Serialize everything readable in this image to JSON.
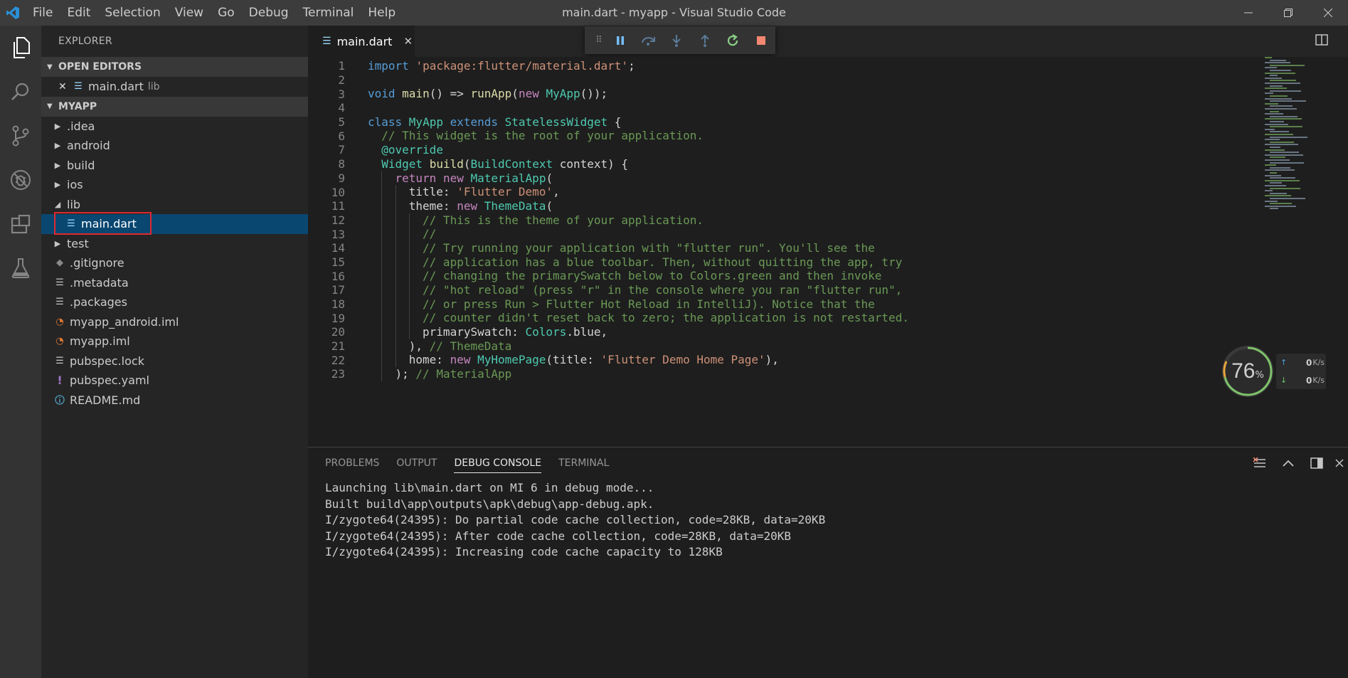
{
  "window": {
    "title": "main.dart - myapp - Visual Studio Code",
    "menu": [
      "File",
      "Edit",
      "Selection",
      "View",
      "Go",
      "Debug",
      "Terminal",
      "Help"
    ]
  },
  "activity_bar": [
    "files-icon",
    "search-icon",
    "source-control-icon",
    "debug-icon",
    "extensions-icon",
    "flask-icon"
  ],
  "sidebar": {
    "header": "EXPLORER",
    "open_editors_label": "OPEN EDITORS",
    "open_editors": [
      {
        "name": "main.dart",
        "folder": "lib"
      }
    ],
    "project_label": "MYAPP",
    "tree": [
      {
        "label": ".idea",
        "kind": "folder"
      },
      {
        "label": "android",
        "kind": "folder"
      },
      {
        "label": "build",
        "kind": "folder"
      },
      {
        "label": "ios",
        "kind": "folder"
      },
      {
        "label": "lib",
        "kind": "folder-open"
      },
      {
        "label": "main.dart",
        "kind": "file",
        "selected": true
      },
      {
        "label": "test",
        "kind": "folder"
      },
      {
        "label": ".gitignore",
        "kind": "git"
      },
      {
        "label": ".metadata",
        "kind": "text"
      },
      {
        "label": ".packages",
        "kind": "text"
      },
      {
        "label": "myapp_android.iml",
        "kind": "rss"
      },
      {
        "label": "myapp.iml",
        "kind": "rss"
      },
      {
        "label": "pubspec.lock",
        "kind": "text"
      },
      {
        "label": "pubspec.yaml",
        "kind": "yaml"
      },
      {
        "label": "README.md",
        "kind": "info"
      }
    ]
  },
  "editor": {
    "tab_label": "main.dart",
    "lines": [
      {
        "n": "1",
        "indent": 0,
        "tokens": [
          [
            "kw",
            "import "
          ],
          [
            "str",
            "'package:flutter/material.dart'"
          ],
          [
            "",
            "; "
          ]
        ]
      },
      {
        "n": "2",
        "indent": 0,
        "tokens": []
      },
      {
        "n": "3",
        "indent": 0,
        "tokens": [
          [
            "kw",
            "void "
          ],
          [
            "fn",
            "main"
          ],
          [
            "",
            "() => "
          ],
          [
            "fn",
            "runApp"
          ],
          [
            "",
            "("
          ],
          [
            "kwc",
            "new "
          ],
          [
            "ty",
            "MyApp"
          ],
          [
            "",
            "());"
          ]
        ]
      },
      {
        "n": "4",
        "indent": 0,
        "tokens": []
      },
      {
        "n": "5",
        "indent": 0,
        "tokens": [
          [
            "kw",
            "class "
          ],
          [
            "ty",
            "MyApp "
          ],
          [
            "kw",
            "extends "
          ],
          [
            "ty",
            "StatelessWidget"
          ],
          [
            "",
            " {"
          ]
        ]
      },
      {
        "n": "6",
        "indent": 1,
        "tokens": [
          [
            "cmt",
            "// This widget is the root of your application."
          ]
        ]
      },
      {
        "n": "7",
        "indent": 1,
        "tokens": [
          [
            "ty",
            "@override"
          ]
        ]
      },
      {
        "n": "8",
        "indent": 1,
        "tokens": [
          [
            "ty",
            "Widget "
          ],
          [
            "fn",
            "build"
          ],
          [
            "",
            "("
          ],
          [
            "ty",
            "BuildContext "
          ],
          [
            "",
            "context) {"
          ]
        ]
      },
      {
        "n": "9",
        "indent": 2,
        "tokens": [
          [
            "kwc",
            "return "
          ],
          [
            "kwc",
            "new "
          ],
          [
            "ty",
            "MaterialApp"
          ],
          [
            "",
            "("
          ]
        ]
      },
      {
        "n": "10",
        "indent": 3,
        "tokens": [
          [
            "",
            "title: "
          ],
          [
            "str",
            "'Flutter Demo'"
          ],
          [
            "",
            ","
          ]
        ]
      },
      {
        "n": "11",
        "indent": 3,
        "tokens": [
          [
            "",
            "theme: "
          ],
          [
            "kwc",
            "new "
          ],
          [
            "ty",
            "ThemeData"
          ],
          [
            "",
            "("
          ]
        ]
      },
      {
        "n": "12",
        "indent": 4,
        "tokens": [
          [
            "cmt",
            "// This is the theme of your application."
          ]
        ]
      },
      {
        "n": "13",
        "indent": 4,
        "tokens": [
          [
            "cmt",
            "//"
          ]
        ]
      },
      {
        "n": "14",
        "indent": 4,
        "tokens": [
          [
            "cmt",
            "// Try running your application with \"flutter run\". You'll see the"
          ]
        ]
      },
      {
        "n": "15",
        "indent": 4,
        "tokens": [
          [
            "cmt",
            "// application has a blue toolbar. Then, without quitting the app, try"
          ]
        ]
      },
      {
        "n": "16",
        "indent": 4,
        "tokens": [
          [
            "cmt",
            "// changing the primarySwatch below to Colors.green and then invoke"
          ]
        ]
      },
      {
        "n": "17",
        "indent": 4,
        "tokens": [
          [
            "cmt",
            "// \"hot reload\" (press \"r\" in the console where you ran \"flutter run\","
          ]
        ]
      },
      {
        "n": "18",
        "indent": 4,
        "tokens": [
          [
            "cmt",
            "// or press Run > Flutter Hot Reload in IntelliJ). Notice that the"
          ]
        ]
      },
      {
        "n": "19",
        "indent": 4,
        "tokens": [
          [
            "cmt",
            "// counter didn't reset back to zero; the application is not restarted."
          ]
        ]
      },
      {
        "n": "20",
        "indent": 4,
        "tokens": [
          [
            "",
            "primarySwatch: "
          ],
          [
            "ty",
            "Colors"
          ],
          [
            "",
            ".blue,"
          ]
        ]
      },
      {
        "n": "21",
        "indent": 3,
        "tokens": [
          [
            "",
            "), "
          ],
          [
            "cmt",
            "// ThemeData"
          ]
        ]
      },
      {
        "n": "22",
        "indent": 3,
        "tokens": [
          [
            "",
            "home: "
          ],
          [
            "kwc",
            "new "
          ],
          [
            "ty",
            "MyHomePage"
          ],
          [
            "",
            "(title: "
          ],
          [
            "str",
            "'Flutter Demo Home Page'"
          ],
          [
            "",
            "),"
          ]
        ]
      },
      {
        "n": "23",
        "indent": 2,
        "tokens": [
          [
            "",
            "); "
          ],
          [
            "cmt",
            "// MaterialApp"
          ]
        ]
      }
    ]
  },
  "net_widget": {
    "percent": "76",
    "percent_sign": "%",
    "up": "0",
    "down": "0",
    "unit": "K/s"
  },
  "panel": {
    "tabs": [
      "PROBLEMS",
      "OUTPUT",
      "DEBUG CONSOLE",
      "TERMINAL"
    ],
    "active_tab": "DEBUG CONSOLE",
    "console": [
      "Launching lib\\main.dart on MI 6 in debug mode...",
      "Built build\\app\\outputs\\apk\\debug\\app-debug.apk.",
      "I/zygote64(24395): Do partial code cache collection, code=28KB, data=20KB",
      "I/zygote64(24395): After code cache collection, code=28KB, data=20KB",
      "I/zygote64(24395): Increasing code cache capacity to 128KB"
    ]
  }
}
